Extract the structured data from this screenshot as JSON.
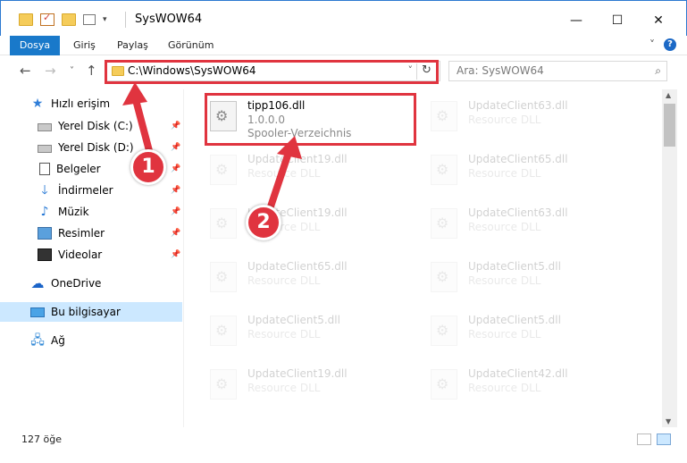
{
  "window": {
    "title": "SysWOW64",
    "controls": {
      "minimize": "—",
      "maximize": "☐",
      "close": "✕"
    }
  },
  "ribbon": {
    "tabs": [
      "Dosya",
      "Giriş",
      "Paylaş",
      "Görünüm"
    ],
    "expand_glyph": "˅",
    "help_glyph": "?"
  },
  "address": {
    "path": "C:\\Windows\\SysWOW64",
    "dropdown_glyph": "˅",
    "refresh_glyph": "↻",
    "back_glyph": "←",
    "forward_glyph": "→",
    "recent_glyph": "˅",
    "up_glyph": "↑"
  },
  "search": {
    "placeholder": "Ara: SysWOW64",
    "icon": "search-icon"
  },
  "sidebar": {
    "items": [
      {
        "label": "Hızlı erişim",
        "icon": "star-icon",
        "pinned": false
      },
      {
        "label": "Yerel Disk (C:)",
        "icon": "drive-icon",
        "pinned": true
      },
      {
        "label": "Yerel Disk (D:)",
        "icon": "drive-icon",
        "pinned": true
      },
      {
        "label": "Belgeler",
        "icon": "documents-icon",
        "pinned": true
      },
      {
        "label": "İndirmeler",
        "icon": "downloads-icon",
        "pinned": true
      },
      {
        "label": "Müzik",
        "icon": "music-icon",
        "pinned": true
      },
      {
        "label": "Resimler",
        "icon": "pictures-icon",
        "pinned": true
      },
      {
        "label": "Videolar",
        "icon": "videos-icon",
        "pinned": true
      },
      {
        "label": "OneDrive",
        "icon": "onedrive-icon",
        "pinned": false
      },
      {
        "label": "Bu bilgisayar",
        "icon": "this-pc-icon",
        "pinned": false,
        "selected": true
      },
      {
        "label": "Ağ",
        "icon": "network-icon",
        "pinned": false
      }
    ],
    "pin_glyph": "📌"
  },
  "files": {
    "highlighted": {
      "name": "tipp106.dll",
      "version": "1.0.0.0",
      "description": "Spooler-Verzeichnis"
    },
    "tiles": [
      {
        "name": "UpdateClient63.dll",
        "type": "Resource DLL"
      },
      {
        "name": "UpdateClient19.dll",
        "type": "Resource DLL"
      },
      {
        "name": "UpdateClient65.dll",
        "type": "Resource DLL"
      },
      {
        "name": "UpdateClient19.dll",
        "type": "Resource DLL"
      },
      {
        "name": "UpdateClient63.dll",
        "type": "Resource DLL"
      },
      {
        "name": "UpdateClient65.dll",
        "type": "Resource DLL"
      },
      {
        "name": "UpdateClient5.dll",
        "type": "Resource DLL"
      },
      {
        "name": "UpdateClient5.dll",
        "type": "Resource DLL"
      },
      {
        "name": "UpdateClient5.dll",
        "type": "Resource DLL"
      },
      {
        "name": "UpdateClient19.dll",
        "type": "Resource DLL"
      },
      {
        "name": "UpdateClient42.dll",
        "type": "Resource DLL"
      }
    ]
  },
  "status": {
    "item_count": "127 öğe"
  },
  "annotations": {
    "step1": "1",
    "step2": "2",
    "color": "#e0343f"
  }
}
